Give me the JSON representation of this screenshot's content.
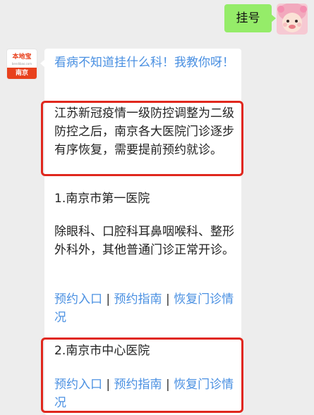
{
  "chat": {
    "user_message": "挂号",
    "bot": {
      "avatar_brand": "本地宝",
      "avatar_domain": "bendibao.com",
      "avatar_city": "南京",
      "intro_link": "看病不知道挂什么科！我教你呀！",
      "notice": "江苏新冠疫情一级防控调整为二级防控之后，南京各大医院门诊逐步有序恢复，需要提前预约就诊。",
      "hospital1_title": "1.南京市第一医院",
      "hospital1_note": "除眼科、口腔科耳鼻咽喉科、整形外科外，其他普通门诊正常开诊。",
      "hospital1_links": [
        "预约入口",
        "预约指南",
        "恢复门诊情况"
      ],
      "hospital2_title": "2.南京市中心医院",
      "hospital2_links": [
        "预约入口",
        "预约指南",
        "恢复门诊情况"
      ],
      "separator": "|"
    }
  },
  "colors": {
    "link": "#4a90e2",
    "highlight": "#e0271d",
    "user_bubble": "#95ec69"
  }
}
